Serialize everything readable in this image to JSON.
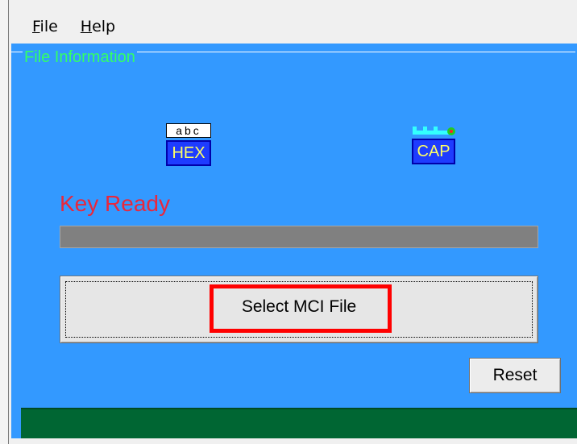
{
  "menu": [
    {
      "mnemonic": "F",
      "rest": "ile"
    },
    {
      "mnemonic": "H",
      "rest": "elp"
    }
  ],
  "file_info": {
    "group_title": "File Information",
    "hex_indicator": {
      "preview": "abc",
      "label": "HEX"
    },
    "cap_indicator": {
      "icon": "caps-lock-key-icon",
      "label": "CAP"
    },
    "status_text": "Key Ready",
    "progress": 0,
    "select_button_label": "Select MCI File",
    "reset_button_label": "Reset"
  },
  "colors": {
    "client_bg": "#3399ff",
    "group_title": "#33ff66",
    "status_text": "#e8283c",
    "status_bar": "#006633",
    "highlight": "#ff0000"
  }
}
